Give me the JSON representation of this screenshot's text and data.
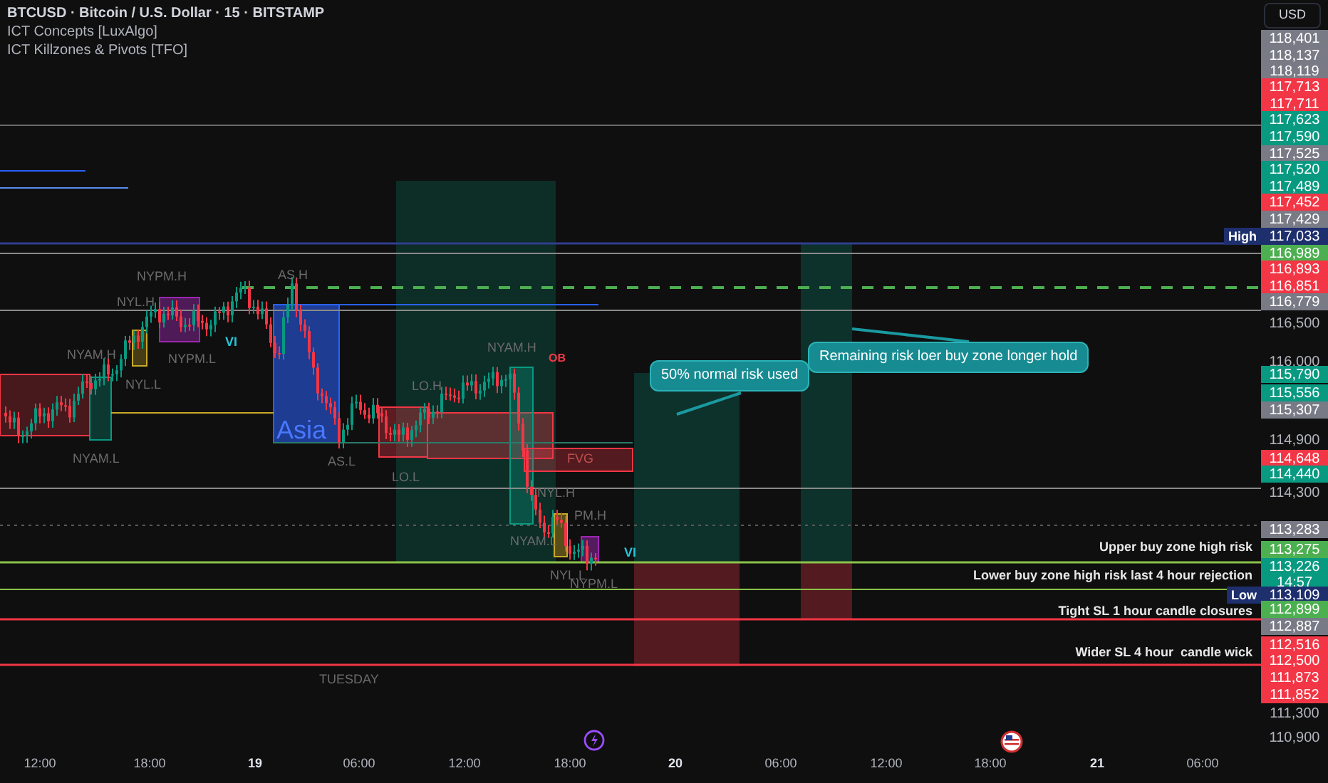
{
  "legend": {
    "symbol": "BTCUSD · Bitcoin / U.S. Dollar · 15 · BITSTAMP",
    "indicators": [
      "ICT Concepts [LuxAlgo]",
      "ICT Killzones & Pivots [TFO]"
    ]
  },
  "currency_button": "USD",
  "chart_labels": [
    {
      "text": "NYPM.H",
      "kind": "session"
    },
    {
      "text": "NYL.H",
      "kind": "session"
    },
    {
      "text": "AS.H",
      "kind": "session"
    },
    {
      "text": "VI",
      "kind": "vi"
    },
    {
      "text": "NYAM.H",
      "kind": "session"
    },
    {
      "text": "NYPM.L",
      "kind": "session"
    },
    {
      "text": "NYL.L",
      "kind": "session"
    },
    {
      "text": "Asia",
      "kind": "box"
    },
    {
      "text": "NYAM.L",
      "kind": "session"
    },
    {
      "text": "AS.L",
      "kind": "session"
    },
    {
      "text": "LO.H",
      "kind": "session"
    },
    {
      "text": "LO.L",
      "kind": "session"
    },
    {
      "text": "NYAM.H",
      "kind": "session"
    },
    {
      "text": "OB",
      "kind": "ob"
    },
    {
      "text": "FVG",
      "kind": "fvg"
    },
    {
      "text": "NYL.H",
      "kind": "session"
    },
    {
      "text": "PM.H",
      "kind": "session"
    },
    {
      "text": "NYAM.L",
      "kind": "session"
    },
    {
      "text": "NYL.L",
      "kind": "session"
    },
    {
      "text": "NYPM.L",
      "kind": "session"
    },
    {
      "text": "VI",
      "kind": "vi"
    },
    {
      "text": "TUESDAY",
      "kind": "session"
    }
  ],
  "callouts": [
    "50% normal risk used",
    "Remaining risk loer buy zone longer hold"
  ],
  "line_labels": [
    "Upper buy zone high risk",
    "Lower buy zone high risk last 4 hour rejection",
    "Tight SL 1 hour candle closures",
    "Wider SL 4 hour  candle wick"
  ],
  "price_axis": [
    {
      "price": "118,401",
      "color": "#787b86"
    },
    {
      "price": "118,137",
      "color": "#787b86"
    },
    {
      "price": "118,119",
      "color": "#787b86"
    },
    {
      "price": "117,713",
      "color": "#f23645"
    },
    {
      "price": "117,711",
      "color": "#f23645"
    },
    {
      "price": "117,623",
      "color": "#089981"
    },
    {
      "price": "117,590",
      "color": "#089981"
    },
    {
      "price": "117,525",
      "color": "#787b86"
    },
    {
      "price": "117,520",
      "color": "#089981"
    },
    {
      "price": "117,489",
      "color": "#089981"
    },
    {
      "price": "117,452",
      "color": "#f23645"
    },
    {
      "price": "117,429",
      "color": "#787b86"
    },
    {
      "price": "117,033",
      "color": "#1e2f6e",
      "tag": "High"
    },
    {
      "price": "116,989",
      "color": "#4caf50"
    },
    {
      "price": "116,893",
      "color": "#f23645"
    },
    {
      "price": "116,851",
      "color": "#f23645"
    },
    {
      "price": "116,779",
      "color": "#787b86"
    },
    {
      "price": "116,500"
    },
    {
      "price": "116,000"
    },
    {
      "price": "115,790",
      "color": "#089981"
    },
    {
      "price": "115,556",
      "color": "#089981"
    },
    {
      "price": "115,307",
      "color": "#787b86"
    },
    {
      "price": "114,900"
    },
    {
      "price": "114,648",
      "color": "#f23645"
    },
    {
      "price": "114,440",
      "color": "#089981"
    },
    {
      "price": "114,300"
    },
    {
      "price": "113,283",
      "color": "#787b86"
    },
    {
      "price": "113,275",
      "color": "#4caf50"
    },
    {
      "price": "113,226",
      "color": "#089981",
      "countdown": "14:57"
    },
    {
      "price": "113,109",
      "color": "#1e2f6e",
      "tag": "Low"
    },
    {
      "price": "112,899",
      "color": "#4caf50"
    },
    {
      "price": "112,887",
      "color": "#787b86"
    },
    {
      "price": "112,516",
      "color": "#f23645"
    },
    {
      "price": "112,500",
      "color": "#f23645"
    },
    {
      "price": "111,873",
      "color": "#f23645"
    },
    {
      "price": "111,852",
      "color": "#f23645"
    },
    {
      "price": "111,300"
    },
    {
      "price": "110,900"
    }
  ],
  "time_axis": [
    {
      "label": "12:00",
      "kind": "time"
    },
    {
      "label": "18:00",
      "kind": "time"
    },
    {
      "label": "19",
      "kind": "day"
    },
    {
      "label": "06:00",
      "kind": "time"
    },
    {
      "label": "12:00",
      "kind": "time"
    },
    {
      "label": "18:00",
      "kind": "time"
    },
    {
      "label": "20",
      "kind": "day"
    },
    {
      "label": "06:00",
      "kind": "time"
    },
    {
      "label": "12:00",
      "kind": "time"
    },
    {
      "label": "18:00",
      "kind": "time"
    },
    {
      "label": "21",
      "kind": "day"
    },
    {
      "label": "06:00",
      "kind": "time"
    }
  ]
}
